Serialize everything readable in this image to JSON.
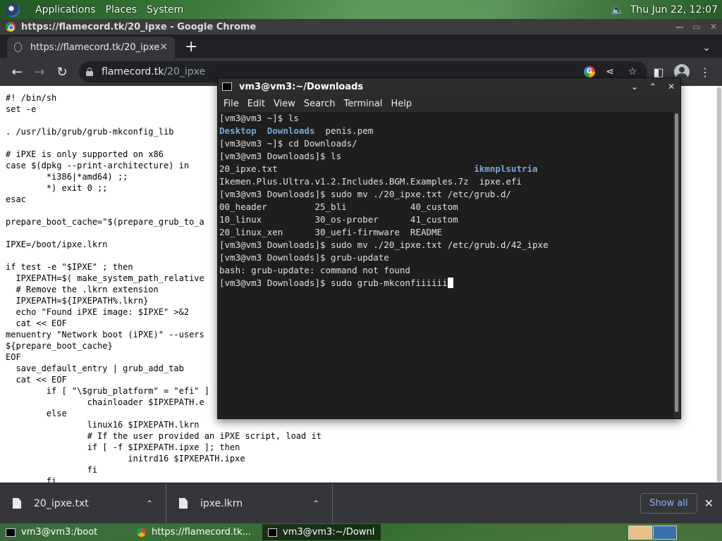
{
  "top_panel": {
    "applications": "Applications",
    "places": "Places",
    "system": "System",
    "clock": "Thu Jun 22, 12:07"
  },
  "chrome": {
    "window_title": "https://flamecord.tk/20_ipxe - Google Chrome",
    "tab_title": "https://flamecord.tk/20_ipxe",
    "tab_close": "✕",
    "new_tab": "+",
    "url_host": "flamecord.tk",
    "url_path": "/20_ipxe",
    "page_text": "#! /bin/sh\nset -e\n\n. /usr/lib/grub/grub-mkconfig_lib\n\n# iPXE is only supported on x86\ncase $(dpkg --print-architecture) in\n        *i386|*amd64) ;;\n        *) exit 0 ;;\nesac\n\nprepare_boot_cache=\"$(prepare_grub_to_a\n\nIPXE=/boot/ipxe.lkrn\n\nif test -e \"$IPXE\" ; then\n  IPXEPATH=$( make_system_path_relative\n  # Remove the .lkrn extension\n  IPXEPATH=${IPXEPATH%.lkrn}\n  echo \"Found iPXE image: $IPXE\" >&2\n  cat << EOF\nmenuentry \"Network boot (iPXE)\" --users\n${prepare_boot_cache}\nEOF\n  save_default_entry | grub_add_tab\n  cat << EOF\n        if [ \"\\$grub_platform\" = \"efi\" ]\n                chainloader $IPXEPATH.e\n        else\n                linux16 $IPXEPATH.lkrn\n                # If the user provided an iPXE script, load it\n                if [ -f $IPXEPATH.ipxe ]; then\n                        initrd16 $IPXEPATH.ipxe\n                fi\n        fi",
    "downloads": [
      {
        "name": "20_ipxe.txt"
      },
      {
        "name": "ipxe.lkrn"
      }
    ],
    "show_all": "Show all"
  },
  "terminal": {
    "title": "vm3@vm3:~/Downloads",
    "menu": [
      "File",
      "Edit",
      "View",
      "Search",
      "Terminal",
      "Help"
    ],
    "lines": [
      {
        "segments": [
          {
            "t": "[vm3@vm3 ~]$ ls"
          }
        ]
      },
      {
        "segments": [
          {
            "t": "Desktop",
            "c": "dir"
          },
          {
            "t": "  "
          },
          {
            "t": "Downloads",
            "c": "dir"
          },
          {
            "t": "  penis.pem"
          }
        ]
      },
      {
        "segments": [
          {
            "t": "[vm3@vm3 ~]$ cd Downloads/"
          }
        ]
      },
      {
        "segments": [
          {
            "t": "[vm3@vm3 Downloads]$ ls"
          }
        ]
      },
      {
        "segments": [
          {
            "t": "20_ipxe.txt                                     "
          },
          {
            "t": "ikmnplsutria",
            "c": "dir"
          }
        ]
      },
      {
        "segments": [
          {
            "t": "Ikemen.Plus.Ultra.v1.2.Includes.BGM.Examples.7z  ipxe.efi"
          }
        ]
      },
      {
        "segments": [
          {
            "t": "[vm3@vm3 Downloads]$ sudo mv ./20_ipxe.txt /etc/grub.d/"
          }
        ]
      },
      {
        "segments": [
          {
            "t": "00_header         25_bli            40_custom"
          }
        ]
      },
      {
        "segments": [
          {
            "t": "10_linux          30_os-prober      41_custom"
          }
        ]
      },
      {
        "segments": [
          {
            "t": "20_linux_xen      30_uefi-firmware  README"
          }
        ]
      },
      {
        "segments": [
          {
            "t": "[vm3@vm3 Downloads]$ sudo mv ./20_ipxe.txt /etc/grub.d/42_ipxe"
          }
        ]
      },
      {
        "segments": [
          {
            "t": "[vm3@vm3 Downloads]$ grub-update"
          }
        ]
      },
      {
        "segments": [
          {
            "t": "bash: grub-update: command not found"
          }
        ]
      },
      {
        "segments": [
          {
            "t": "[vm3@vm3 Downloads]$ sudo grub-mkconfiiiiii"
          }
        ],
        "cursor": true
      }
    ]
  },
  "taskbar": {
    "tasks": [
      {
        "label": "vm3@vm3:/boot",
        "icon": "terminal-icon"
      },
      {
        "label": "https://flamecord.tk...",
        "icon": "chrome-icon"
      },
      {
        "label": "vm3@vm3:~/Downl...",
        "icon": "terminal-icon",
        "active": true
      }
    ]
  }
}
